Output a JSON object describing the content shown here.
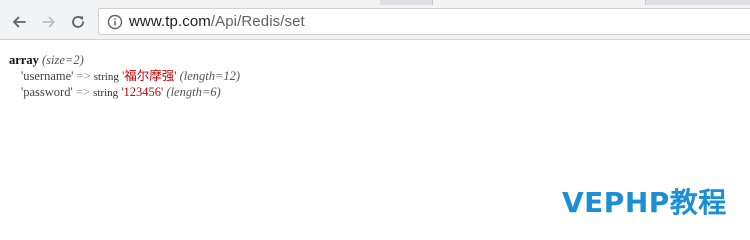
{
  "browser": {
    "url_host": "www.tp.com",
    "url_path": "/Api/Redis/set"
  },
  "dump": {
    "header_keyword": "array",
    "header_meta": "(size=2)",
    "rows": [
      {
        "key": "'username'",
        "arrow": "=>",
        "type": "string",
        "value": "'福尔摩强'",
        "length": "(length=12)"
      },
      {
        "key": "'password'",
        "arrow": "=>",
        "type": "string",
        "value": "'123456'",
        "length": "(length=6)"
      }
    ]
  },
  "watermark": {
    "text": "VEPHP教程"
  },
  "colors": {
    "string_value": "#cc0000",
    "watermark": "#1a8fd6"
  },
  "icons": [
    "back-arrow-icon",
    "forward-arrow-icon",
    "reload-icon",
    "info-icon"
  ]
}
